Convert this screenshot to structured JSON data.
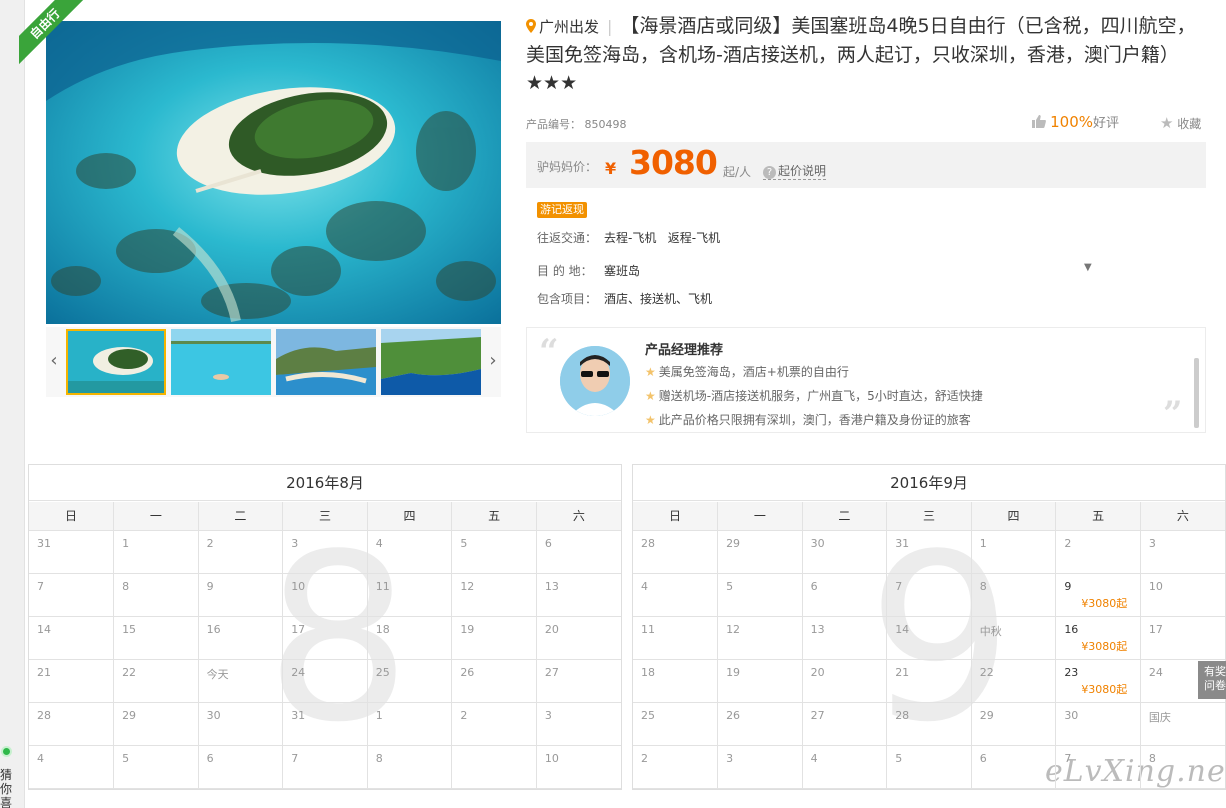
{
  "edge": {
    "text": "猜你喜"
  },
  "gallery": {
    "ribbon": "自由行",
    "thumbs": [
      "island",
      "sea",
      "beach",
      "cliff"
    ],
    "active_index": 0
  },
  "product": {
    "origin": "广州出发",
    "title": "【海景酒店或同级】美国塞班岛4晚5日自由行（已含税，四川航空， 美国免签海岛，含机场-酒店接送机，两人起订，只收深圳，香港，澳门户籍）★★★",
    "code_label": "产品编号：",
    "code": "850498",
    "rating_pct": "100%",
    "rating_label": "好评",
    "fav_label": "收藏",
    "price_label": "驴妈妈价：",
    "currency": "¥",
    "price": "3080",
    "price_unit": "起/人",
    "price_explain": "起价说明",
    "badge": "游记返现",
    "rows": [
      {
        "k": "往返交通：",
        "v": "去程-飞机   返程-飞机"
      },
      {
        "k": "目 的 地：",
        "v": "塞班岛",
        "dropdown": "▼"
      },
      {
        "k": "包含项目：",
        "v": "酒店、接送机、飞机"
      }
    ]
  },
  "manager": {
    "title": "产品经理推荐",
    "lines": [
      "美属免签海岛，酒店+机票的自由行",
      "赠送机场-酒店接送机服务，广州直飞，5小时直达，舒适快捷",
      "此产品价格只限拥有深圳，澳门，香港户籍及身份证的旅客"
    ]
  },
  "calendars": [
    {
      "title": "2016年8月",
      "big": "8",
      "weekdays": [
        "日",
        "一",
        "二",
        "三",
        "四",
        "五",
        "六"
      ],
      "weeks": [
        [
          {
            "d": "31"
          },
          {
            "d": "1"
          },
          {
            "d": "2"
          },
          {
            "d": "3"
          },
          {
            "d": "4"
          },
          {
            "d": "5"
          },
          {
            "d": "6"
          }
        ],
        [
          {
            "d": "7"
          },
          {
            "d": "8"
          },
          {
            "d": "9"
          },
          {
            "d": "10"
          },
          {
            "d": "11"
          },
          {
            "d": "12"
          },
          {
            "d": "13"
          }
        ],
        [
          {
            "d": "14"
          },
          {
            "d": "15"
          },
          {
            "d": "16"
          },
          {
            "d": "17"
          },
          {
            "d": "18"
          },
          {
            "d": "19"
          },
          {
            "d": "20"
          }
        ],
        [
          {
            "d": "21"
          },
          {
            "d": "22"
          },
          {
            "d": "今天"
          },
          {
            "d": "24"
          },
          {
            "d": "25"
          },
          {
            "d": "26"
          },
          {
            "d": "27"
          }
        ],
        [
          {
            "d": "28"
          },
          {
            "d": "29"
          },
          {
            "d": "30"
          },
          {
            "d": "31"
          },
          {
            "d": "1"
          },
          {
            "d": "2"
          },
          {
            "d": "3"
          }
        ],
        [
          {
            "d": "4"
          },
          {
            "d": "5"
          },
          {
            "d": "6"
          },
          {
            "d": "7"
          },
          {
            "d": "8"
          },
          {
            "d": ""
          },
          {
            "d": "10"
          }
        ]
      ]
    },
    {
      "title": "2016年9月",
      "big": "9",
      "weekdays": [
        "日",
        "一",
        "二",
        "三",
        "四",
        "五",
        "六"
      ],
      "weeks": [
        [
          {
            "d": "28"
          },
          {
            "d": "29"
          },
          {
            "d": "30"
          },
          {
            "d": "31"
          },
          {
            "d": "1"
          },
          {
            "d": "2"
          },
          {
            "d": "3"
          }
        ],
        [
          {
            "d": "4"
          },
          {
            "d": "5"
          },
          {
            "d": "6"
          },
          {
            "d": "7"
          },
          {
            "d": "8"
          },
          {
            "d": "9",
            "p": "¥3080起"
          },
          {
            "d": "10"
          }
        ],
        [
          {
            "d": "11"
          },
          {
            "d": "12"
          },
          {
            "d": "13"
          },
          {
            "d": "14"
          },
          {
            "d": "中秋"
          },
          {
            "d": "16",
            "p": "¥3080起"
          },
          {
            "d": "17"
          }
        ],
        [
          {
            "d": "18"
          },
          {
            "d": "19"
          },
          {
            "d": "20"
          },
          {
            "d": "21"
          },
          {
            "d": "22"
          },
          {
            "d": "23",
            "p": "¥3080起"
          },
          {
            "d": "24"
          }
        ],
        [
          {
            "d": "25"
          },
          {
            "d": "26"
          },
          {
            "d": "27"
          },
          {
            "d": "28"
          },
          {
            "d": "29"
          },
          {
            "d": "30"
          },
          {
            "d": "国庆"
          }
        ],
        [
          {
            "d": "2"
          },
          {
            "d": "3"
          },
          {
            "d": "4"
          },
          {
            "d": "5"
          },
          {
            "d": "6"
          },
          {
            "d": "7"
          },
          {
            "d": "8"
          }
        ]
      ]
    }
  ],
  "side_float": "有奖问卷",
  "watermark": "eLvXing.net"
}
